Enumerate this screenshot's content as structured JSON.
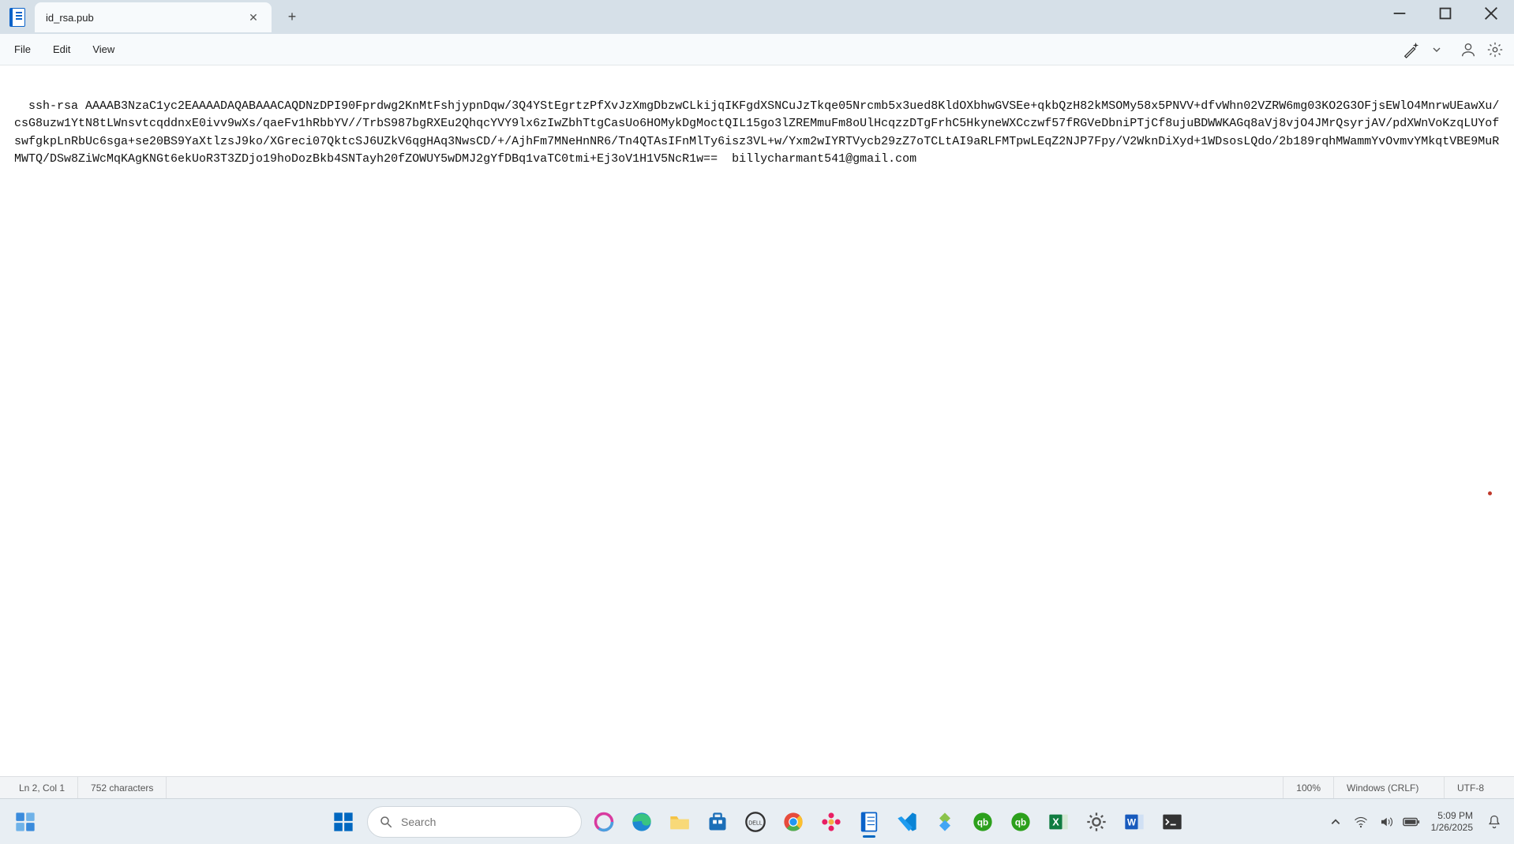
{
  "window": {
    "tab_title": "id_rsa.pub",
    "close_glyph": "✕",
    "new_tab_glyph": "+"
  },
  "menu": {
    "file": "File",
    "edit": "Edit",
    "view": "View"
  },
  "editor": {
    "content": "ssh-rsa AAAAB3NzaC1yc2EAAAADAQABAAACAQDNzDPI90Fprdwg2KnMtFshjypnDqw/3Q4YStEgrtzPfXvJzXmgDbzwCLkijqIKFgdXSNCuJzTkqe05Nrcmb5x3ued8KldOXbhwGVSEe+qkbQzH82kMSOMy58x5PNVV+dfvWhn02VZRW6mg03KO2G3OFjsEWlO4MnrwUEawXu/csG8uzw1YtN8tLWnsvtcqddnxE0ivv9wXs/qaeFv1hRbbYV//TrbS987bgRXEu2QhqcYVY9lx6zIwZbhTtgCasUo6HOMykDgMoctQIL15go3lZREMmuFm8oUlHcqzzDTgFrhC5HkyneWXCczwf57fRGVeDbniPTjCf8ujuBDWWKAGq8aVj8vjO4JMrQsyrjAV/pdXWnVoKzqLUYofswfgkpLnRbUc6sga+se20BS9YaXtlzsJ9ko/XGreci07QktcSJ6UZkV6qgHAq3NwsCD/+/AjhFm7MNeHnNR6/Tn4QTAsIFnMlTy6isz3VL+w/Yxm2wIYRTVycb29zZ7oTCLtAI9aRLFMTpwLEqZ2NJP7Fpy/V2WknDiXyd+1WDsosLQdo/2b189rqhMWammYvOvmvYMkqtVBE9MuRMWTQ/DSw8ZiWcMqKAgKNGt6ekUoR3T3ZDjo19hoDozBkb4SNTayh20fZOWUY5wDMJ2gYfDBq1vaTC0tmi+Ej3oV1H1V5NcR1w==  billycharmant541@gmail.com"
  },
  "status": {
    "position": "Ln 2, Col 1",
    "chars": "752 characters",
    "zoom": "100%",
    "line_endings": "Windows (CRLF)",
    "encoding": "UTF-8"
  },
  "taskbar": {
    "search_placeholder": "Search"
  },
  "tray": {
    "time": "5:09 PM",
    "date": "1/26/2025"
  }
}
